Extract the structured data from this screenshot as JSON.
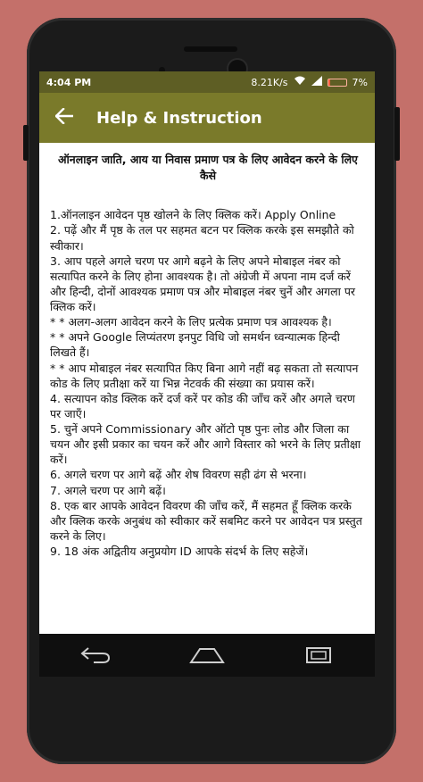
{
  "status_bar": {
    "time": "4:04 PM",
    "speed": "8.21K/s",
    "battery": "7%"
  },
  "app_bar": {
    "title": "Help & Instruction"
  },
  "content": {
    "heading": "ऑनलाइन जाति, आय या निवास प्रमाण पत्र के लिए आवेदन करने के लिए कैसे",
    "steps": [
      "1.ऑनलाइन आवेदन पृष्ठ खोलने के लिए क्लिक करें। Apply Online",
      "2. पढ़ें और मैं पृष्ठ के तल पर सहमत बटन पर क्लिक करके इस समझौते को स्वीकार।",
      "3. आप पहले अगले चरण पर आगे बढ़ने के लिए अपने मोबाइल नंबर को सत्यापित करने के लिए होना आवश्यक है। तो अंग्रेजी में अपना नाम दर्ज करें और हिन्दी, दोनों आवश्यक प्रमाण पत्र और मोबाइल नंबर चुनें और अगला पर क्लिक करें।",
      "* * अलग-अलग आवेदन करने के लिए प्रत्येक प्रमाण पत्र आवश्यक है।",
      "* * अपने Google लिप्यंतरण इनपुट विधि जो समर्थन ध्वन्यात्मक हिन्दी लिखते हैं।",
      "* * आप मोबाइल नंबर सत्यापित किए बिना आगे नहीं बढ़ सकता तो सत्यापन कोड के लिए प्रतीक्षा करें या भिन्न नेटवर्क की संख्या का प्रयास करें।",
      "4. सत्यापन कोड क्लिक करें दर्ज करें पर कोड की जाँच करें और अगले चरण पर जाएँ।",
      "5. चुनें अपने Commissionary और ऑटो पृष्ठ पुनः लोड और जिला का चयन और इसी प्रकार का चयन करें और आगे विस्तार को भरने के लिए प्रतीक्षा करें।",
      "6. अगले चरण पर आगे बढ़ें और शेष विवरण सही ढंग से भरना।",
      "7. अगले चरण पर आगे बढ़ें।",
      "8. एक बार आपके आवेदन विवरण की जाँच करें, मैं सहमत हूँ क्लिक करके और क्लिक करके अनुबंध को स्वीकार करें सबमिट करने पर आवेदन पत्र प्रस्तुत करने के लिए।",
      "9. 18 अंक अद्वितीय अनुप्रयोग ID आपके संदर्भ के लिए सहेजें।"
    ]
  },
  "icons": {
    "back": "arrow-left-icon",
    "wifi": "wifi-icon",
    "signal": "signal-icon",
    "nav_back": "nav-back-icon",
    "nav_home": "nav-home-icon",
    "nav_recents": "nav-recents-icon"
  },
  "colors": {
    "status_bar": "#5e5e24",
    "app_bar": "#7a7a2a",
    "background": "#c4706a"
  }
}
